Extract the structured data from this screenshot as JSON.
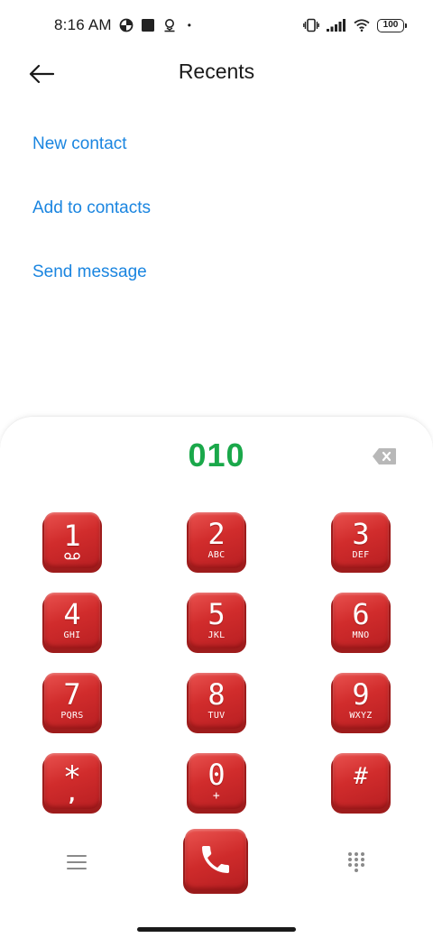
{
  "status_bar": {
    "time": "8:16 AM",
    "battery": "100",
    "dot": "•"
  },
  "header": {
    "title": "Recents"
  },
  "actions": {
    "new_contact": "New contact",
    "add_to_contacts": "Add to contacts",
    "send_message": "Send message"
  },
  "dialer": {
    "number": "010",
    "keys": [
      {
        "digit": "1",
        "letters": ""
      },
      {
        "digit": "2",
        "letters": "ABC"
      },
      {
        "digit": "3",
        "letters": "DEF"
      },
      {
        "digit": "4",
        "letters": "GHI"
      },
      {
        "digit": "5",
        "letters": "JKL"
      },
      {
        "digit": "6",
        "letters": "MNO"
      },
      {
        "digit": "7",
        "letters": "PQRS"
      },
      {
        "digit": "8",
        "letters": "TUV"
      },
      {
        "digit": "9",
        "letters": "WXYZ"
      },
      {
        "digit": "*",
        "letters": ","
      },
      {
        "digit": "0",
        "letters": "+"
      },
      {
        "digit": "#",
        "letters": ""
      }
    ]
  },
  "colors": {
    "accent_link": "#1a85e0",
    "number_green": "#1aa84a",
    "key_red": "#d12c2c"
  },
  "icons": {
    "back": "arrow-left-icon",
    "backspace": "backspace-icon",
    "voicemail": "voicemail-icon",
    "call": "phone-icon",
    "menu": "menu-icon",
    "dialpad": "dialpad-icon"
  }
}
